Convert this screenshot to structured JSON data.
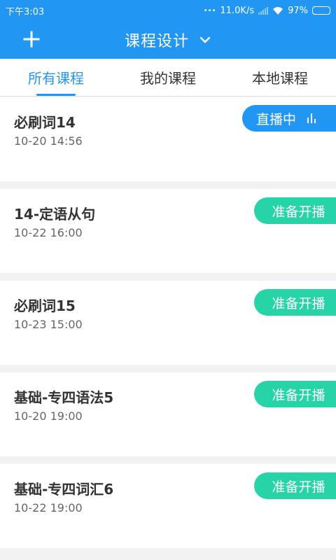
{
  "status_bar": {
    "time": "下午3:03",
    "dots": "•••",
    "speed": "11.0K/s",
    "battery": "97%"
  },
  "header": {
    "title": "课程设计",
    "add_icon": "plus-icon",
    "dropdown_icon": "chevron-down-icon"
  },
  "tabs": [
    {
      "label": "所有课程",
      "active": true
    },
    {
      "label": "我的课程",
      "active": false
    },
    {
      "label": "本地课程",
      "active": false
    }
  ],
  "courses": [
    {
      "name": "必刷词14",
      "date": "10-20 14:56",
      "status": "直播中",
      "status_type": "live"
    },
    {
      "name": "14-定语从句",
      "date": "10-22 16:00",
      "status": "准备开播",
      "status_type": "ready"
    },
    {
      "name": "必刷词15",
      "date": "10-23 15:00",
      "status": "准备开播",
      "status_type": "ready"
    },
    {
      "name": "基础-专四语法5",
      "date": "10-20 19:00",
      "status": "准备开播",
      "status_type": "ready"
    },
    {
      "name": "基础-专四词汇6",
      "date": "10-22 19:00",
      "status": "准备开播",
      "status_type": "ready"
    }
  ],
  "colors": {
    "primary": "#2196f3",
    "ready": "#26d4a8",
    "background": "#f2f2f2"
  }
}
